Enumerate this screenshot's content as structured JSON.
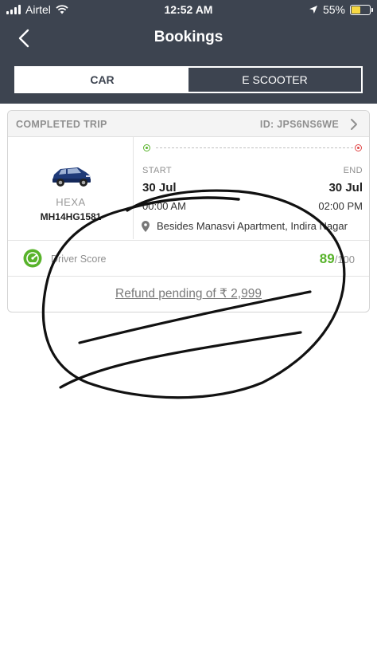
{
  "status_bar": {
    "carrier": "Airtel",
    "time": "12:52 AM",
    "battery_percent": "55%",
    "battery_level": 0.55,
    "icons": [
      "signal-icon",
      "wifi-icon",
      "location-arrow-icon",
      "battery-charging-icon"
    ]
  },
  "nav": {
    "title": "Bookings",
    "back_icon": "chevron-left-icon"
  },
  "tabs": [
    {
      "label": "CAR",
      "active": true
    },
    {
      "label": "E SCOOTER",
      "active": false
    }
  ],
  "booking": {
    "status": "COMPLETED TRIP",
    "id": "ID: JPS6NS6WE",
    "car_model": "HEXA",
    "plate": "MH14HG1581",
    "start_label": "START",
    "end_label": "END",
    "start_date": "30 Jul",
    "end_date": "30 Jul",
    "start_time": "00:00 AM",
    "end_time": "02:00 PM",
    "location": "Besides Manasvi Apartment, Indira Nagar",
    "driver_score_label": "Driver Score",
    "driver_score": "89",
    "driver_score_max": "/100",
    "refund_text": "Refund pending of ₹ 2,999"
  },
  "colors": {
    "header_bg": "#3d4450",
    "score_green": "#58b32b",
    "start_dot": "#58b32b",
    "end_dot": "#e04646",
    "battery_fill": "#f7d842"
  }
}
